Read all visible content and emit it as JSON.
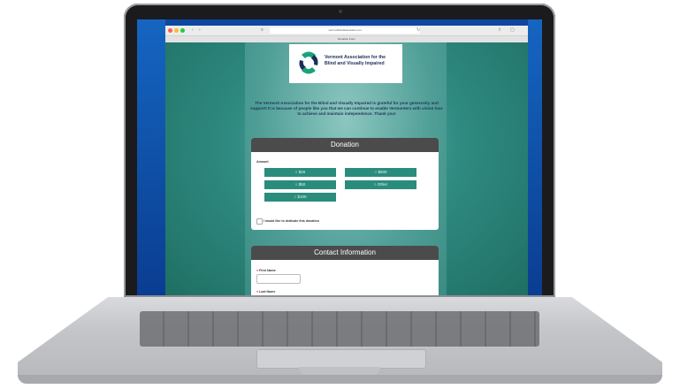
{
  "browser": {
    "url": "vermontblindassociation.net",
    "tab_title": "Donation Form"
  },
  "logo": {
    "line1": "Vermont Association for the",
    "line2": "Blind and Visually Impaired"
  },
  "intro_text": "The Vermont Association for the Blind and Visually Impaired is grateful for your generosity and support! It is because of people like you that we can continue to enable Vermonters with vision loss to achieve and maintain independence. Thank you!",
  "donation": {
    "title": "Donation",
    "amount_label": "Amount",
    "options": [
      "$25",
      "$500",
      "$50",
      "Other",
      "$100"
    ],
    "dedicate_label": "I would like to dedicate this donation"
  },
  "contact": {
    "title": "Contact Information",
    "first_name_label": "First Name",
    "last_name_label": "Last Name"
  },
  "colors": {
    "accent": "#2a8c7c",
    "card_header": "#4b4b4b",
    "page_bg": "#2f8a80"
  }
}
